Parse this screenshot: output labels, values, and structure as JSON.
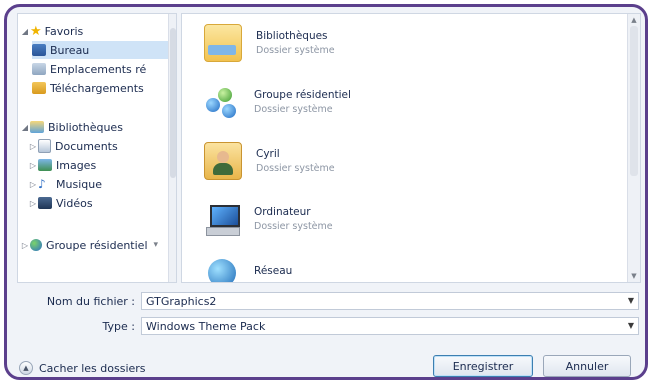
{
  "nav": {
    "favorites": {
      "label": "Favoris",
      "expander": "◢"
    },
    "favorites_items": [
      {
        "label": "Bureau",
        "icon": "desktop-icon"
      },
      {
        "label": "Emplacements ré",
        "icon": "recent-places-icon"
      },
      {
        "label": "Téléchargements",
        "icon": "downloads-icon"
      }
    ],
    "libraries": {
      "label": "Bibliothèques",
      "expander": "◢"
    },
    "libraries_items": [
      {
        "label": "Documents",
        "icon": "documents-icon",
        "expander": "▷"
      },
      {
        "label": "Images",
        "icon": "images-icon",
        "expander": "▷"
      },
      {
        "label": "Musique",
        "icon": "music-icon",
        "expander": "▷"
      },
      {
        "label": "Vidéos",
        "icon": "videos-icon",
        "expander": "▷"
      }
    ],
    "homegroup": {
      "label": "Groupe résidentiel",
      "expander": "▷",
      "scroll_mark": "▾"
    }
  },
  "items": [
    {
      "title": "Bibliothèques",
      "subtitle": "Dossier système",
      "icon": "libraries-folder-icon"
    },
    {
      "title": "Groupe résidentiel",
      "subtitle": "Dossier système",
      "icon": "homegroup-icon"
    },
    {
      "title": "Cyril",
      "subtitle": "Dossier système",
      "icon": "user-folder-icon"
    },
    {
      "title": "Ordinateur",
      "subtitle": "Dossier système",
      "icon": "computer-icon"
    },
    {
      "title": "Réseau",
      "subtitle": "",
      "icon": "network-icon"
    }
  ],
  "filename": {
    "label": "Nom du fichier :",
    "value": "GTGraphics2",
    "arrow": "▼"
  },
  "filetype": {
    "label": "Type :",
    "value": "Windows Theme Pack",
    "arrow": "▼"
  },
  "footer": {
    "hide_folders": "Cacher les dossiers",
    "hide_icon": "▲",
    "save": "Enregistrer",
    "cancel": "Annuler"
  },
  "colors": {
    "frame": "#5b3f8c",
    "selection": "#cfe3f7",
    "accent": "#3c7fb1"
  }
}
